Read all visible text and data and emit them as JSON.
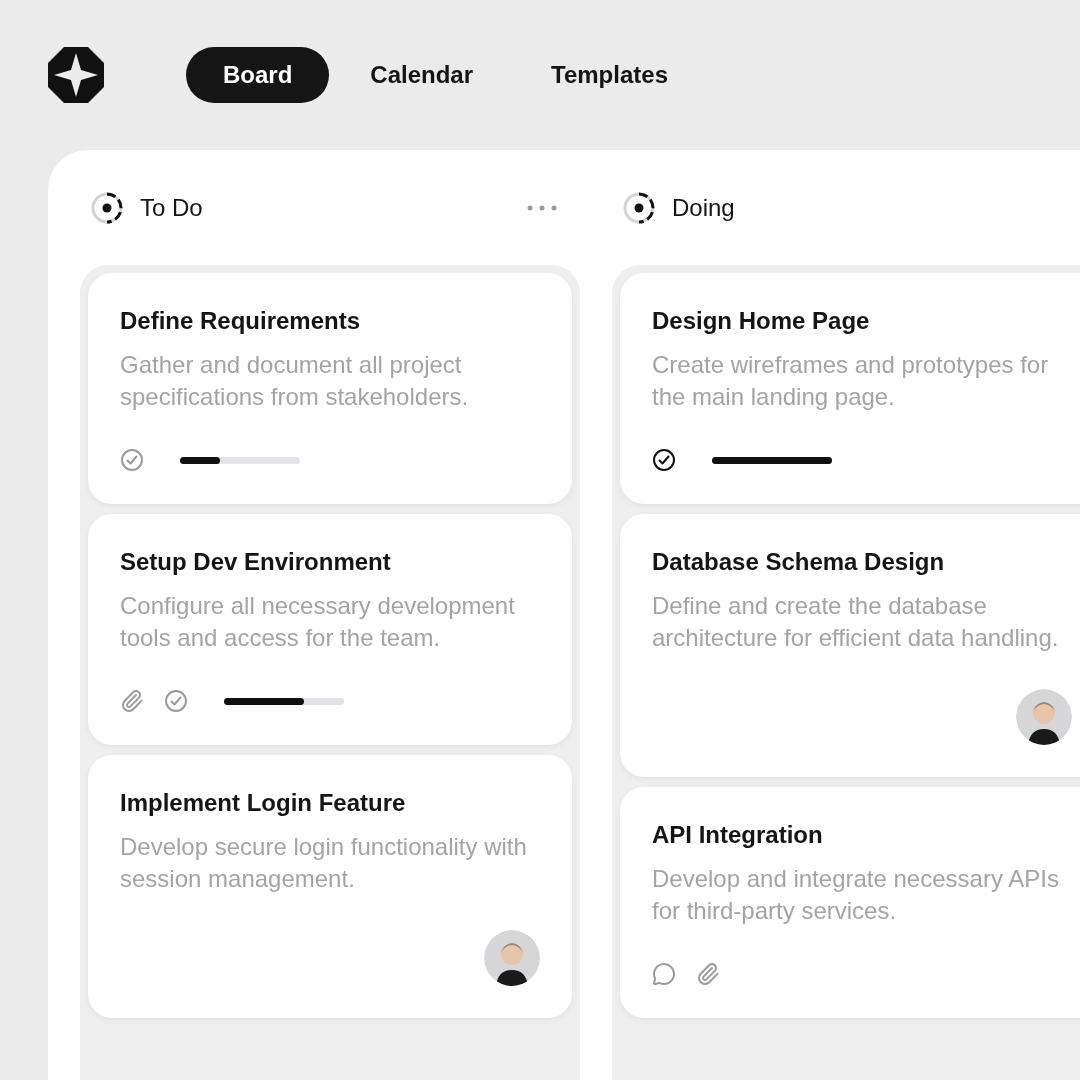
{
  "tabs": [
    {
      "label": "Board",
      "selected": true
    },
    {
      "label": "Calendar",
      "selected": false
    },
    {
      "label": "Templates",
      "selected": false
    }
  ],
  "columns": [
    {
      "title": "To Do",
      "actions": [
        {
          "kind": "more"
        }
      ],
      "cards": [
        {
          "title": "Define Requirements",
          "description": "Gather and document all project specifications from stakeholders.",
          "footer": [
            {
              "kind": "checklist",
              "done": false
            },
            {
              "kind": "progress",
              "level": 0.33
            }
          ]
        },
        {
          "title": "Setup Dev Environment",
          "description": "Configure all necessary development tools and access for the team.",
          "footer": [
            {
              "kind": "attachment"
            },
            {
              "kind": "checklist",
              "done": false
            },
            {
              "kind": "progress",
              "level": 0.67
            }
          ]
        },
        {
          "title": "Implement Login Feature",
          "description": "Develop secure login functionality with session management.",
          "footer": [
            {
              "kind": "avatar"
            }
          ]
        }
      ]
    },
    {
      "title": "Doing",
      "cards": [
        {
          "title": "Design Home Page",
          "description": "Create wireframes and prototypes for the main landing page.",
          "footer": [
            {
              "kind": "checklist",
              "done": true
            },
            {
              "kind": "progress",
              "level": 1
            }
          ]
        },
        {
          "title": "Database Schema Design",
          "description": "Define and create the database architecture for efficient data handling.",
          "footer": [
            {
              "kind": "avatar"
            }
          ]
        },
        {
          "title": "API Integration",
          "description": "Develop and integrate necessary APIs for third-party services.",
          "footer": [
            {
              "kind": "comment"
            },
            {
              "kind": "attachment"
            }
          ]
        }
      ]
    }
  ]
}
